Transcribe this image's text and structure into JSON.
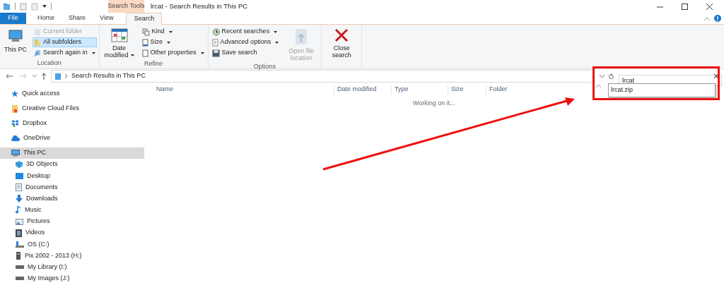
{
  "window": {
    "title": "lrcat - Search Results in This PC",
    "context_tab_label": "Search Tools"
  },
  "tabs": [
    {
      "label": "File",
      "kind": "file",
      "selected": false
    },
    {
      "label": "Home",
      "kind": "tab",
      "selected": false
    },
    {
      "label": "Share",
      "kind": "tab",
      "selected": false
    },
    {
      "label": "View",
      "kind": "tab",
      "selected": false
    },
    {
      "label": "Search",
      "kind": "context",
      "selected": true
    }
  ],
  "ribbon": {
    "groups": [
      {
        "label": "Location",
        "items": [
          {
            "label": "This PC",
            "kind": "large",
            "dropdown": false,
            "disabled": false,
            "selected": false
          },
          {
            "label": "Current folder",
            "kind": "small",
            "dropdown": false,
            "disabled": true,
            "selected": false
          },
          {
            "label": "All subfolders",
            "kind": "small",
            "dropdown": false,
            "disabled": false,
            "selected": true
          },
          {
            "label": "Search again in",
            "kind": "small",
            "dropdown": true,
            "disabled": false,
            "selected": false
          }
        ]
      },
      {
        "label": "Refine",
        "items": [
          {
            "label": "Date modified",
            "kind": "large",
            "dropdown": true,
            "disabled": false,
            "selected": false
          },
          {
            "label": "Kind",
            "kind": "small",
            "dropdown": true,
            "disabled": false,
            "selected": false
          },
          {
            "label": "Size",
            "kind": "small",
            "dropdown": true,
            "disabled": false,
            "selected": false
          },
          {
            "label": "Other properties",
            "kind": "small",
            "dropdown": true,
            "disabled": false,
            "selected": false
          }
        ]
      },
      {
        "label": "Options",
        "items": [
          {
            "label": "Recent searches",
            "kind": "small",
            "dropdown": true,
            "disabled": false,
            "selected": false
          },
          {
            "label": "Advanced options",
            "kind": "small",
            "dropdown": true,
            "disabled": false,
            "selected": false
          },
          {
            "label": "Save search",
            "kind": "small",
            "dropdown": false,
            "disabled": false,
            "selected": false
          },
          {
            "label": "Open file location",
            "kind": "large",
            "dropdown": false,
            "disabled": true,
            "selected": false
          }
        ]
      },
      {
        "items": [
          {
            "label": "Close search",
            "kind": "large",
            "dropdown": false,
            "disabled": false,
            "selected": false
          }
        ]
      }
    ]
  },
  "address": {
    "path": "Search Results in This PC"
  },
  "search": {
    "value": "lrcat",
    "suggestions": [
      "lrcat.zip"
    ]
  },
  "sidebar": {
    "items": [
      {
        "label": "Quick access",
        "selected": false
      },
      {
        "label": "Creative Cloud Files",
        "selected": false
      },
      {
        "label": "Dropbox",
        "selected": false
      },
      {
        "label": "OneDrive",
        "selected": false
      },
      {
        "label": "This PC",
        "selected": true,
        "children": [
          {
            "label": "3D Objects",
            "selected": false
          },
          {
            "label": "Desktop",
            "selected": false
          },
          {
            "label": "Documents",
            "selected": false
          },
          {
            "label": "Downloads",
            "selected": false
          },
          {
            "label": "Music",
            "selected": false
          },
          {
            "label": "Pictures",
            "selected": false
          },
          {
            "label": "Videos",
            "selected": false
          },
          {
            "label": "OS (C:)",
            "selected": false
          },
          {
            "label": "Pix 2002 - 2013 (H:)",
            "selected": false
          },
          {
            "label": "My Library (I:)",
            "selected": false
          },
          {
            "label": "My Images (J:)",
            "selected": false
          }
        ]
      }
    ]
  },
  "table": {
    "columns": [
      "Name",
      "Date modified",
      "Type",
      "Size",
      "Folder"
    ],
    "status": "Working on it..."
  }
}
